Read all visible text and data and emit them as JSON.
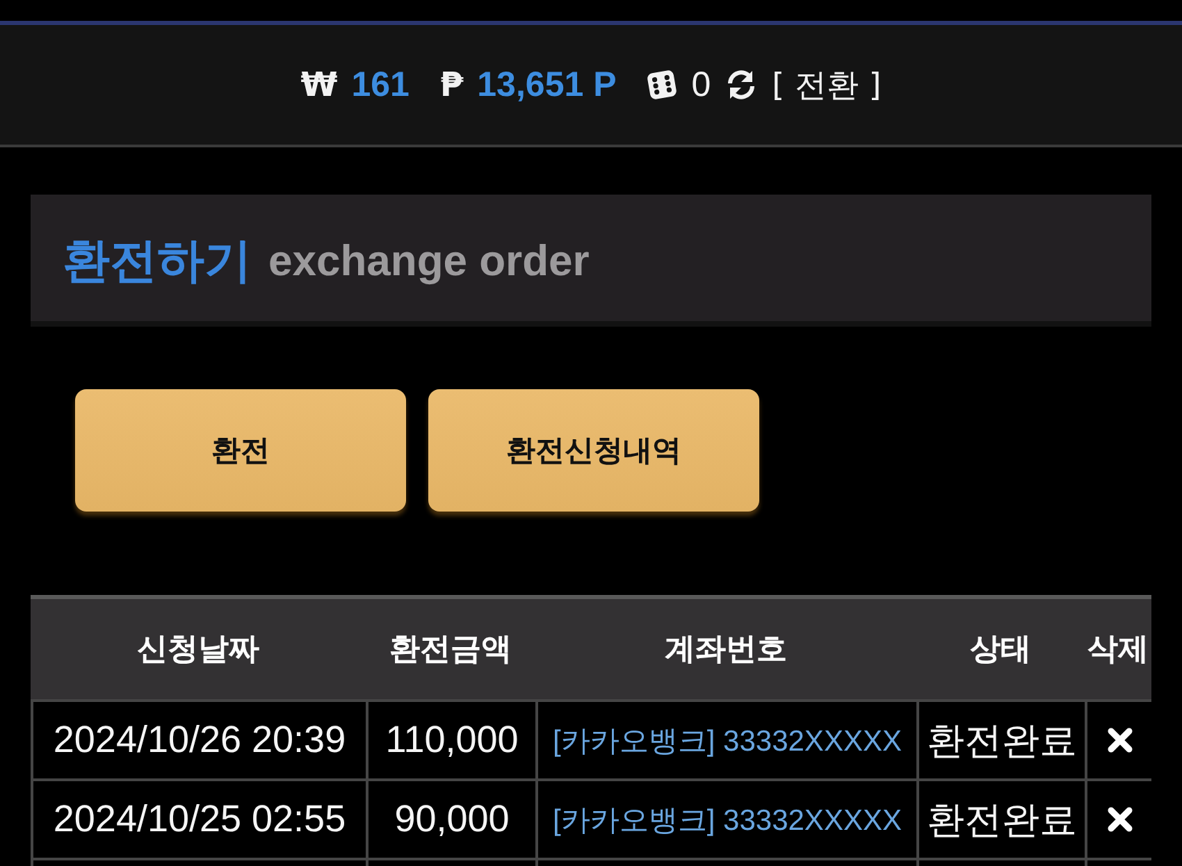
{
  "balance": {
    "won_symbol": "₩",
    "won_amount": "161",
    "point_symbol": "₱",
    "point_amount": "13,651 P",
    "dice_count": "0",
    "switch_label": "[ 전환 ]"
  },
  "section": {
    "title": "환전하기",
    "subtitle": "exchange order"
  },
  "buttons": [
    {
      "label": "환전"
    },
    {
      "label": "환전신청내역"
    }
  ],
  "table": {
    "columns": [
      "신청날짜",
      "환전금액",
      "계좌번호",
      "상태",
      "삭제"
    ],
    "rows": [
      {
        "date": "2024/10/26 20:39",
        "amount": "110,000",
        "account": "[카카오뱅크] 33332XXXXX",
        "status": "환전완료"
      },
      {
        "date": "2024/10/25 02:55",
        "amount": "90,000",
        "account": "[카카오뱅크] 33332XXXXX",
        "status": "환전완료"
      }
    ]
  }
}
